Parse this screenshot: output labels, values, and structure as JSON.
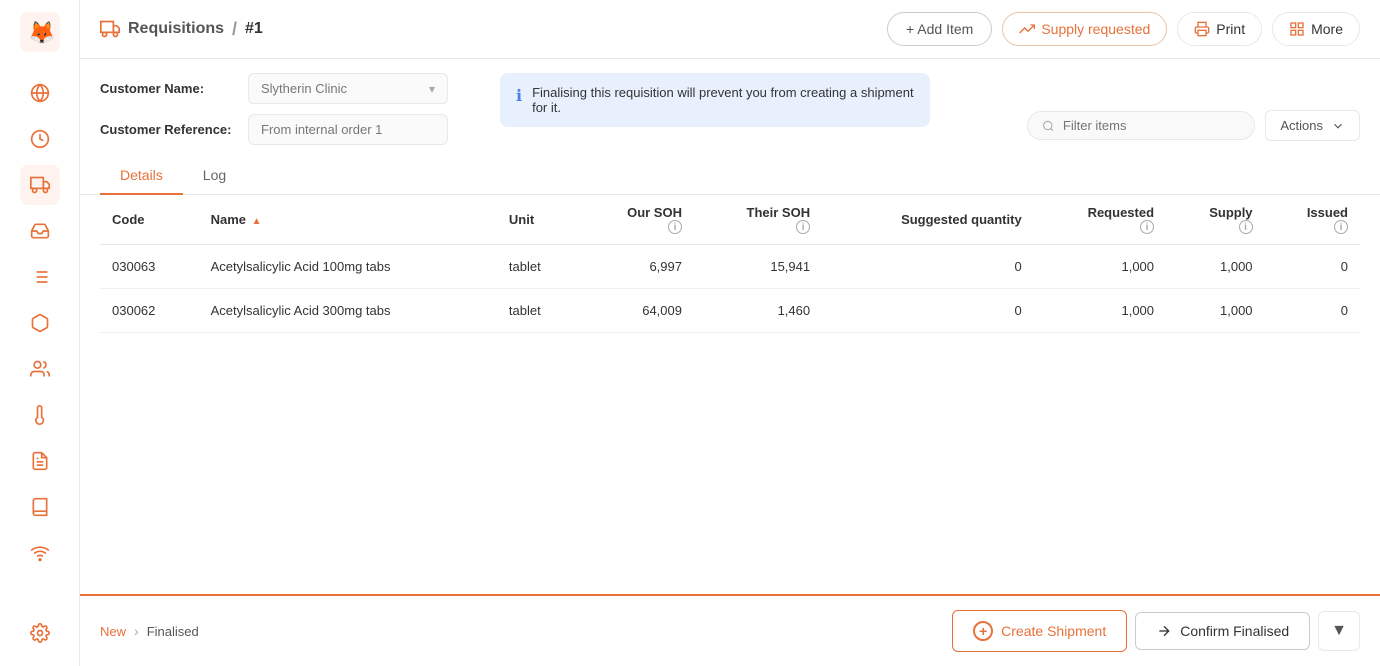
{
  "sidebar": {
    "items": [
      {
        "id": "globe",
        "icon": "🌐",
        "active": false
      },
      {
        "id": "clock",
        "icon": "⏱",
        "active": false
      },
      {
        "id": "truck",
        "icon": "🚚",
        "active": true
      },
      {
        "id": "inbox",
        "icon": "📥",
        "active": false
      },
      {
        "id": "list",
        "icon": "☰",
        "active": false
      },
      {
        "id": "box",
        "icon": "📦",
        "active": false
      },
      {
        "id": "users",
        "icon": "👥",
        "active": false
      },
      {
        "id": "thermometer",
        "icon": "🌡",
        "active": false
      },
      {
        "id": "document",
        "icon": "📄",
        "active": false
      },
      {
        "id": "book",
        "icon": "📖",
        "active": false
      },
      {
        "id": "wifi",
        "icon": "📡",
        "active": false
      }
    ],
    "bottom": [
      {
        "id": "settings",
        "icon": "⚙️"
      }
    ]
  },
  "header": {
    "breadcrumb_root": "Requisitions",
    "breadcrumb_sep": "/",
    "breadcrumb_current": "#1",
    "truck_icon": "🚚",
    "add_item_label": "+ Add Item",
    "supply_requested_label": "Supply requested",
    "print_label": "Print",
    "more_label": "More"
  },
  "form": {
    "customer_name_label": "Customer Name:",
    "customer_name_value": "Slytherin Clinic",
    "customer_reference_label": "Customer Reference:",
    "customer_reference_value": "From internal order 1"
  },
  "info_banner": {
    "text": "Finalising this requisition will prevent you from creating a shipment for it."
  },
  "toolbar": {
    "filter_placeholder": "Filter items",
    "actions_label": "Actions"
  },
  "tabs": [
    {
      "id": "details",
      "label": "Details",
      "active": true
    },
    {
      "id": "log",
      "label": "Log",
      "active": false
    }
  ],
  "table": {
    "columns": [
      {
        "id": "code",
        "label": "Code",
        "align": "left"
      },
      {
        "id": "name",
        "label": "Name",
        "align": "left",
        "sortable": true
      },
      {
        "id": "unit",
        "label": "Unit",
        "align": "left"
      },
      {
        "id": "our_soh",
        "label": "Our SOH",
        "align": "right",
        "info": true
      },
      {
        "id": "their_soh",
        "label": "Their SOH",
        "align": "right",
        "info": true
      },
      {
        "id": "suggested_quantity",
        "label": "Suggested quantity",
        "align": "right"
      },
      {
        "id": "requested",
        "label": "Requested",
        "align": "right",
        "info": true
      },
      {
        "id": "supply",
        "label": "Supply",
        "align": "right",
        "info": true
      },
      {
        "id": "issued",
        "label": "Issued",
        "align": "right",
        "info": true
      }
    ],
    "rows": [
      {
        "code": "030063",
        "name": "Acetylsalicylic Acid 100mg tabs",
        "unit": "tablet",
        "our_soh": "6,997",
        "their_soh": "15,941",
        "suggested_quantity": "0",
        "requested": "1,000",
        "supply": "1,000",
        "issued": "0"
      },
      {
        "code": "030062",
        "name": "Acetylsalicylic Acid 300mg tabs",
        "unit": "tablet",
        "our_soh": "64,009",
        "their_soh": "1,460",
        "suggested_quantity": "0",
        "requested": "1,000",
        "supply": "1,000",
        "issued": "0"
      }
    ]
  },
  "footer": {
    "steps": [
      {
        "label": "New",
        "active": true
      },
      {
        "label": "Finalised",
        "active": false
      }
    ],
    "create_shipment_label": "Create Shipment",
    "confirm_finalised_label": "Confirm Finalised",
    "chevron_icon": "▼"
  }
}
